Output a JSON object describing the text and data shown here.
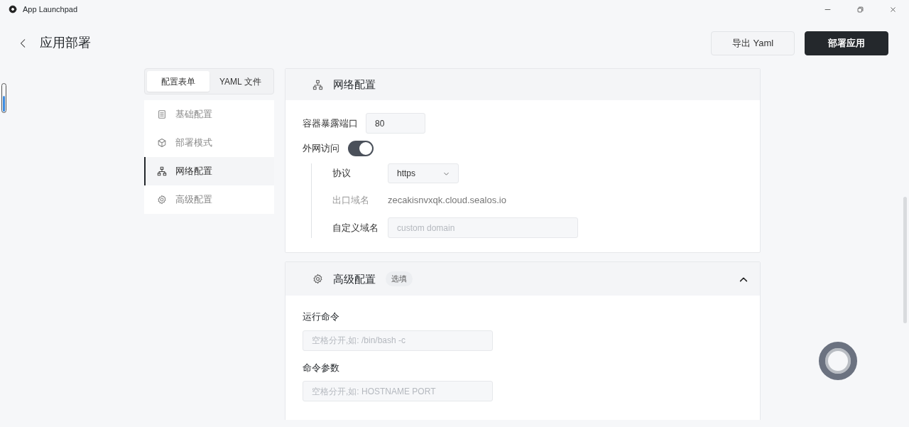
{
  "window": {
    "title": "App Launchpad"
  },
  "header": {
    "title": "应用部署",
    "buttons": [
      {
        "label": "导出 Yaml",
        "kind": "secondary"
      },
      {
        "label": "部署应用",
        "kind": "primary"
      }
    ]
  },
  "tabs": [
    {
      "label": "配置表单",
      "selected": true
    },
    {
      "label": "YAML 文件",
      "selected": false
    }
  ],
  "nav": [
    {
      "label": "基础配置",
      "selected": false
    },
    {
      "label": "部署模式",
      "selected": false
    },
    {
      "label": "网络配置",
      "selected": true
    },
    {
      "label": "高级配置",
      "selected": false
    }
  ],
  "network": {
    "title": "网络配置",
    "port": {
      "label": "容器暴露端口",
      "value": "80"
    },
    "public_access": {
      "label": "外网访问",
      "on": true
    },
    "protocol": {
      "label": "协议",
      "value": "https"
    },
    "domain": {
      "label": "出口域名",
      "value": "zecakisnvxqk.cloud.sealos.io"
    },
    "custom_domain": {
      "label": "自定义域名",
      "placeholder": "custom domain"
    }
  },
  "advanced": {
    "title": "高级配置",
    "badge": "选填",
    "expanded": true,
    "fields": [
      {
        "label": "运行命令",
        "placeholder": "空格分开,如: /bin/bash -c"
      },
      {
        "label": "命令参数",
        "placeholder": "空格分开,如: HOSTNAME PORT"
      }
    ]
  }
}
